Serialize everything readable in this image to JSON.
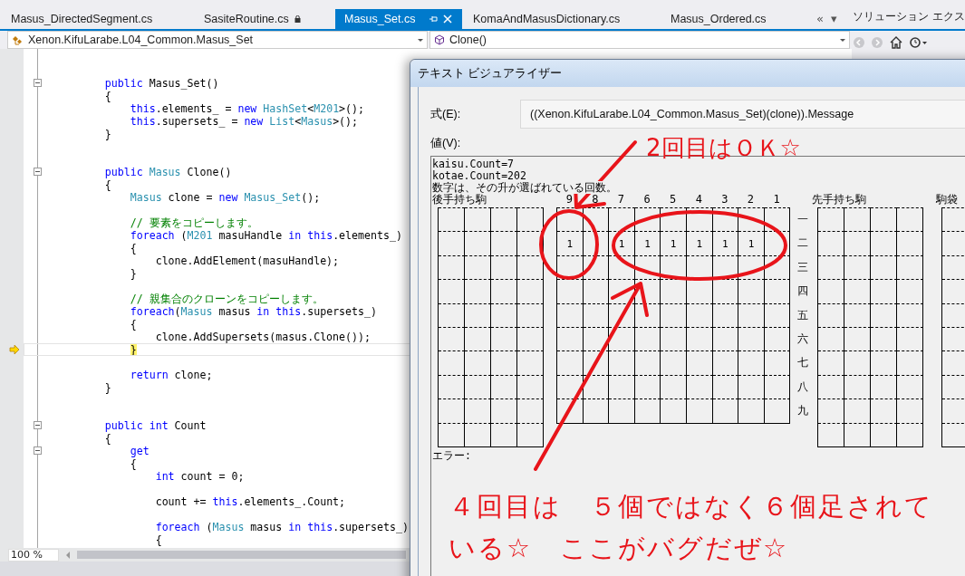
{
  "tabs": [
    {
      "label": "Masus_DirectedSegment.cs",
      "selected": false,
      "locked": false
    },
    {
      "label": "SasiteRoutine.cs",
      "selected": false,
      "locked": true
    },
    {
      "label": "Masus_Set.cs",
      "selected": true,
      "locked": false
    },
    {
      "label": "KomaAndMasusDictionary.cs",
      "selected": false,
      "locked": false
    },
    {
      "label": "Masus_Ordered.cs",
      "selected": false,
      "locked": false
    }
  ],
  "tab_overflow": {
    "scroll": "«",
    "menu": "▾"
  },
  "navigation": {
    "type_selector": "Xenon.KifuLarabe.L04_Common.Masus_Set",
    "member_selector": "Clone()"
  },
  "solution_explorer": {
    "title": "ソリューション エクス"
  },
  "code_lines": [
    {
      "kind": "blank",
      "fold": false,
      "current": false
    },
    {
      "kind": "blank",
      "fold": false,
      "current": false
    },
    {
      "kind": "code",
      "fold": true,
      "current": false,
      "segs": [
        {
          "kind": "keyword",
          "text": "        public"
        },
        {
          "kind": "plain",
          "text": " Masus_Set()"
        }
      ]
    },
    {
      "kind": "code",
      "fold": false,
      "current": false,
      "segs": [
        {
          "kind": "plain",
          "text": "        {"
        }
      ]
    },
    {
      "kind": "code",
      "fold": false,
      "current": false,
      "segs": [
        {
          "kind": "keyword",
          "text": "            this"
        },
        {
          "kind": "plain",
          "text": ".elements_ = "
        },
        {
          "kind": "keyword",
          "text": "new "
        },
        {
          "kind": "type",
          "text": "HashSet"
        },
        {
          "kind": "plain",
          "text": "<"
        },
        {
          "kind": "type",
          "text": "M201"
        },
        {
          "kind": "plain",
          "text": ">();"
        }
      ]
    },
    {
      "kind": "code",
      "fold": false,
      "current": false,
      "segs": [
        {
          "kind": "keyword",
          "text": "            this"
        },
        {
          "kind": "plain",
          "text": ".supersets_ = "
        },
        {
          "kind": "keyword",
          "text": "new "
        },
        {
          "kind": "type",
          "text": "List"
        },
        {
          "kind": "plain",
          "text": "<"
        },
        {
          "kind": "type",
          "text": "Masus"
        },
        {
          "kind": "plain",
          "text": ">();"
        }
      ]
    },
    {
      "kind": "code",
      "fold": false,
      "current": false,
      "segs": [
        {
          "kind": "plain",
          "text": "        }"
        }
      ]
    },
    {
      "kind": "blank",
      "fold": false,
      "current": false
    },
    {
      "kind": "blank",
      "fold": false,
      "current": false
    },
    {
      "kind": "code",
      "fold": true,
      "current": false,
      "segs": [
        {
          "kind": "keyword",
          "text": "        public "
        },
        {
          "kind": "type",
          "text": "Masus"
        },
        {
          "kind": "plain",
          "text": " Clone()"
        }
      ]
    },
    {
      "kind": "code",
      "fold": false,
      "current": false,
      "segs": [
        {
          "kind": "plain",
          "text": "        {"
        }
      ]
    },
    {
      "kind": "code",
      "fold": false,
      "current": false,
      "segs": [
        {
          "kind": "type",
          "text": "            Masus"
        },
        {
          "kind": "plain",
          "text": " clone = "
        },
        {
          "kind": "keyword",
          "text": "new "
        },
        {
          "kind": "type",
          "text": "Masus_Set"
        },
        {
          "kind": "plain",
          "text": "();"
        }
      ]
    },
    {
      "kind": "blank",
      "fold": false,
      "current": false
    },
    {
      "kind": "code",
      "fold": false,
      "current": false,
      "segs": [
        {
          "kind": "comment",
          "text": "            // 要素をコピーします。"
        }
      ]
    },
    {
      "kind": "code",
      "fold": false,
      "current": false,
      "segs": [
        {
          "kind": "keyword",
          "text": "            foreach"
        },
        {
          "kind": "plain",
          "text": " ("
        },
        {
          "kind": "type",
          "text": "M201"
        },
        {
          "kind": "plain",
          "text": " masuHandle "
        },
        {
          "kind": "keyword",
          "text": "in this"
        },
        {
          "kind": "plain",
          "text": ".elements_)"
        }
      ]
    },
    {
      "kind": "code",
      "fold": false,
      "current": false,
      "segs": [
        {
          "kind": "plain",
          "text": "            {"
        }
      ]
    },
    {
      "kind": "code",
      "fold": false,
      "current": false,
      "segs": [
        {
          "kind": "plain",
          "text": "                clone.AddElement(masuHandle);"
        }
      ]
    },
    {
      "kind": "code",
      "fold": false,
      "current": false,
      "segs": [
        {
          "kind": "plain",
          "text": "            }"
        }
      ]
    },
    {
      "kind": "blank",
      "fold": false,
      "current": false
    },
    {
      "kind": "code",
      "fold": false,
      "current": false,
      "segs": [
        {
          "kind": "comment",
          "text": "            // 親集合のクローンをコピーします。"
        }
      ]
    },
    {
      "kind": "code",
      "fold": false,
      "current": false,
      "segs": [
        {
          "kind": "keyword",
          "text": "            foreach"
        },
        {
          "kind": "plain",
          "text": "("
        },
        {
          "kind": "type",
          "text": "Masus"
        },
        {
          "kind": "plain",
          "text": " masus "
        },
        {
          "kind": "keyword",
          "text": "in this"
        },
        {
          "kind": "plain",
          "text": ".supersets_)"
        }
      ]
    },
    {
      "kind": "code",
      "fold": false,
      "current": false,
      "segs": [
        {
          "kind": "plain",
          "text": "            {"
        }
      ]
    },
    {
      "kind": "code",
      "fold": false,
      "current": false,
      "segs": [
        {
          "kind": "plain",
          "text": "                clone.AddSupersets(masus.Clone());"
        }
      ]
    },
    {
      "kind": "code",
      "fold": false,
      "current": true,
      "segs": [
        {
          "kind": "brace",
          "text": "}"
        }
      ]
    },
    {
      "kind": "blank",
      "fold": false,
      "current": false
    },
    {
      "kind": "code",
      "fold": false,
      "current": false,
      "segs": [
        {
          "kind": "keyword",
          "text": "            return"
        },
        {
          "kind": "plain",
          "text": " clone;"
        }
      ]
    },
    {
      "kind": "code",
      "fold": false,
      "current": false,
      "segs": [
        {
          "kind": "plain",
          "text": "        }"
        }
      ]
    },
    {
      "kind": "blank",
      "fold": false,
      "current": false
    },
    {
      "kind": "blank",
      "fold": false,
      "current": false
    },
    {
      "kind": "code",
      "fold": true,
      "current": false,
      "segs": [
        {
          "kind": "keyword",
          "text": "        public int"
        },
        {
          "kind": "plain",
          "text": " Count"
        }
      ]
    },
    {
      "kind": "code",
      "fold": false,
      "current": false,
      "segs": [
        {
          "kind": "plain",
          "text": "        {"
        }
      ]
    },
    {
      "kind": "code",
      "fold": true,
      "current": false,
      "segs": [
        {
          "kind": "keyword",
          "text": "            get"
        }
      ]
    },
    {
      "kind": "code",
      "fold": false,
      "current": false,
      "segs": [
        {
          "kind": "plain",
          "text": "            {"
        }
      ]
    },
    {
      "kind": "code",
      "fold": false,
      "current": false,
      "segs": [
        {
          "kind": "keyword",
          "text": "                int"
        },
        {
          "kind": "plain",
          "text": " count = 0;"
        }
      ]
    },
    {
      "kind": "blank",
      "fold": false,
      "current": false
    },
    {
      "kind": "code",
      "fold": false,
      "current": false,
      "segs": [
        {
          "kind": "plain",
          "text": "                count += "
        },
        {
          "kind": "keyword",
          "text": "this"
        },
        {
          "kind": "plain",
          "text": ".elements_.Count;"
        }
      ]
    },
    {
      "kind": "blank",
      "fold": false,
      "current": false
    },
    {
      "kind": "code",
      "fold": false,
      "current": false,
      "segs": [
        {
          "kind": "keyword",
          "text": "                foreach"
        },
        {
          "kind": "plain",
          "text": " ("
        },
        {
          "kind": "type",
          "text": "Masus"
        },
        {
          "kind": "plain",
          "text": " masus "
        },
        {
          "kind": "keyword",
          "text": "in this"
        },
        {
          "kind": "plain",
          "text": ".supersets_)"
        }
      ]
    },
    {
      "kind": "code",
      "fold": false,
      "current": false,
      "segs": [
        {
          "kind": "plain",
          "text": "                {"
        }
      ]
    }
  ],
  "zoom": "100 %",
  "dialog": {
    "title": "テキスト ビジュアライザー",
    "expression_label": "式(E):",
    "expression": "((Xenon.KifuLarabe.L04_Common.Masus_Set)(clone)).Message",
    "value_label": "値(V):",
    "value_lines": [
      "kaisu.Count=7",
      "kotae.Count=202",
      "数字は、その升が選ばれている回数。"
    ],
    "gote_hand_label": "後手持ち駒",
    "sente_hand_label": "先手持ち駒",
    "bag_label": "駒袋",
    "files": [
      "9",
      "8",
      "7",
      "6",
      "5",
      "4",
      "3",
      "2",
      "1"
    ],
    "ranks": [
      {
        "label": "一",
        "cells": [
          null,
          null,
          null,
          null,
          null,
          null,
          null,
          null,
          null
        ]
      },
      {
        "label": "二",
        "cells": [
          "1",
          null,
          "1",
          "1",
          "1",
          "1",
          "1",
          "1",
          null
        ]
      },
      {
        "label": "三",
        "cells": [
          null,
          null,
          null,
          null,
          null,
          null,
          null,
          null,
          null
        ]
      },
      {
        "label": "四",
        "cells": [
          null,
          null,
          null,
          null,
          null,
          null,
          null,
          null,
          null
        ]
      },
      {
        "label": "五",
        "cells": [
          null,
          null,
          null,
          null,
          null,
          null,
          null,
          null,
          null
        ]
      },
      {
        "label": "六",
        "cells": [
          null,
          null,
          null,
          null,
          null,
          null,
          null,
          null,
          null
        ]
      },
      {
        "label": "七",
        "cells": [
          null,
          null,
          null,
          null,
          null,
          null,
          null,
          null,
          null
        ]
      },
      {
        "label": "八",
        "cells": [
          null,
          null,
          null,
          null,
          null,
          null,
          null,
          null,
          null
        ]
      },
      {
        "label": "九",
        "cells": [
          null,
          null,
          null,
          null,
          null,
          null,
          null,
          null,
          null
        ]
      }
    ],
    "error_label": "エラー:"
  },
  "annotations": [
    {
      "kind": "top",
      "text": "2回目はＯＫ☆"
    },
    {
      "kind": "bottom",
      "text": "４回目は　５個ではなく６個足されている☆　ここがバグだぜ☆"
    }
  ]
}
